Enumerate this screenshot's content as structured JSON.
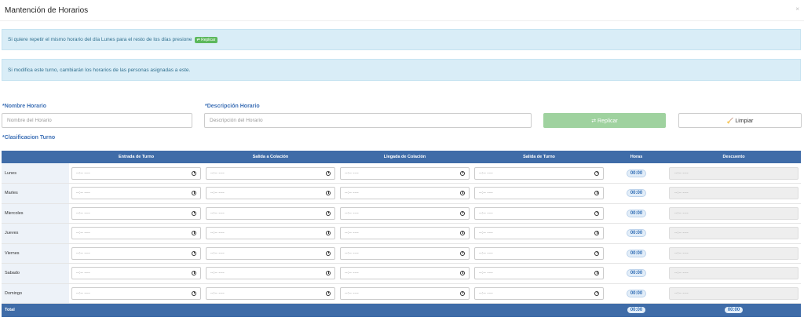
{
  "modal": {
    "title": "Mantención de Horarios",
    "close": "×"
  },
  "alerts": {
    "replicate_text": "Si quiere repetir el mismo horario del día Lunes para el resto de los días presione",
    "replicate_btn": "⇄ Replicar",
    "warning": "Si modifica este turno, cambiarán los horarios de las personas asignadas a este."
  },
  "form": {
    "nombre_label": "*Nombre Horario",
    "nombre_placeholder": "Nombre del Horario",
    "descripcion_label": "*Descripción Horario",
    "descripcion_placeholder": "Descripción del Horario",
    "replicar_button": "⇄ Replicar",
    "limpiar_button": "🧹 Limpiar",
    "clasificacion_label": "*Clasificacion Turno"
  },
  "table": {
    "headers": [
      "",
      "Entrada de Turno",
      "Salida a Colación",
      "Llegada de Colación",
      "Salida de Turno",
      "Horas",
      "Descuento"
    ],
    "time_placeholder": "--:-- ----",
    "rows": [
      {
        "day": "Lunes",
        "horas": "00:00",
        "descuento": "--:-- ----"
      },
      {
        "day": "Martes",
        "horas": "00:00",
        "descuento": "--:-- ----"
      },
      {
        "day": "Miercoles",
        "horas": "00:00",
        "descuento": "--:-- ----"
      },
      {
        "day": "Jueves",
        "horas": "00:00",
        "descuento": "--:-- ----"
      },
      {
        "day": "Viernes",
        "horas": "00:00",
        "descuento": "--:-- ----"
      },
      {
        "day": "Sabado",
        "horas": "00:00",
        "descuento": "--:-- ----"
      },
      {
        "day": "Domingo",
        "horas": "00:00",
        "descuento": "--:-- ----"
      }
    ],
    "footer": {
      "label": "Total",
      "horas": "00:00",
      "descuento": "00:00"
    }
  },
  "colors": {
    "header_blue": "#3f6ca8",
    "alert_bg": "#d9edf7",
    "replicar_green": "#9fd29f"
  }
}
